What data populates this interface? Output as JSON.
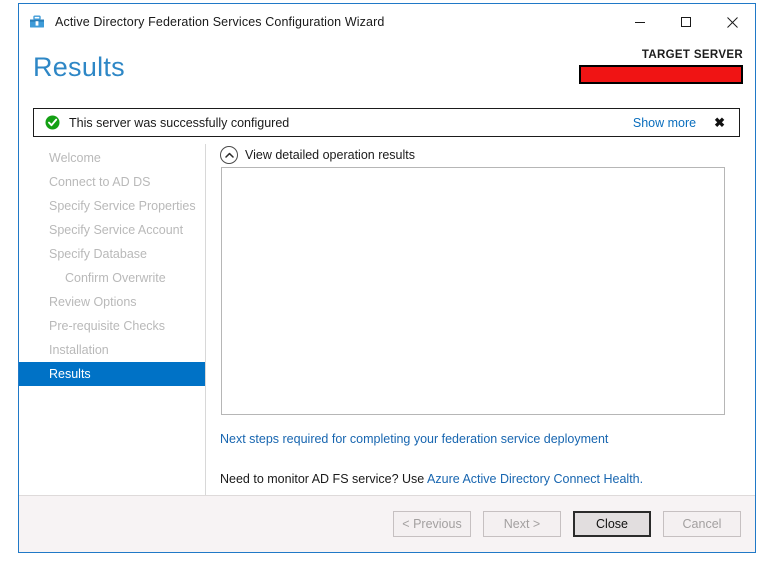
{
  "window": {
    "title": "Active Directory Federation Services Configuration Wizard",
    "app_icon": "server-manager-icon",
    "controls": {
      "minimize": "minimize-icon",
      "maximize": "maximize-icon",
      "close": "close-icon"
    },
    "border_color": "#2079c7"
  },
  "header": {
    "page_title": "Results",
    "page_title_color": "#2e87c6",
    "target_server_label": "TARGET SERVER",
    "target_server_value": "",
    "redaction_color": "#f01414"
  },
  "notification": {
    "icon": "success-check-icon",
    "icon_color": "#14a014",
    "message": "This server was successfully configured",
    "show_more_label": "Show more",
    "close_label": "✖"
  },
  "sidebar": {
    "items": [
      {
        "label": "Welcome",
        "state": "disabled",
        "indented": false
      },
      {
        "label": "Connect to AD DS",
        "state": "disabled",
        "indented": false
      },
      {
        "label": "Specify Service Properties",
        "state": "disabled",
        "indented": false
      },
      {
        "label": "Specify Service Account",
        "state": "disabled",
        "indented": false
      },
      {
        "label": "Specify Database",
        "state": "disabled",
        "indented": false
      },
      {
        "label": "Confirm Overwrite",
        "state": "disabled",
        "indented": true
      },
      {
        "label": "Review Options",
        "state": "disabled",
        "indented": false
      },
      {
        "label": "Pre-requisite Checks",
        "state": "disabled",
        "indented": false
      },
      {
        "label": "Installation",
        "state": "disabled",
        "indented": false
      },
      {
        "label": "Results",
        "state": "active",
        "indented": false
      }
    ],
    "active_color": "#0072c6"
  },
  "content": {
    "detail_toggle_label": "View detailed operation results",
    "detail_toggle_icon": "chevron-up-circle-icon",
    "detail_panel_text": "",
    "next_steps_link": "Next steps required for completing your federation service deployment",
    "monitor_prefix": "Need to monitor AD FS service? Use ",
    "monitor_link": "Azure Active Directory Connect Health.",
    "link_color": "#1866b0"
  },
  "footer": {
    "buttons": [
      {
        "label": "< Previous",
        "state": "disabled"
      },
      {
        "label": "Next >",
        "state": "disabled"
      },
      {
        "label": "Close",
        "state": "default"
      },
      {
        "label": "Cancel",
        "state": "disabled"
      }
    ]
  }
}
